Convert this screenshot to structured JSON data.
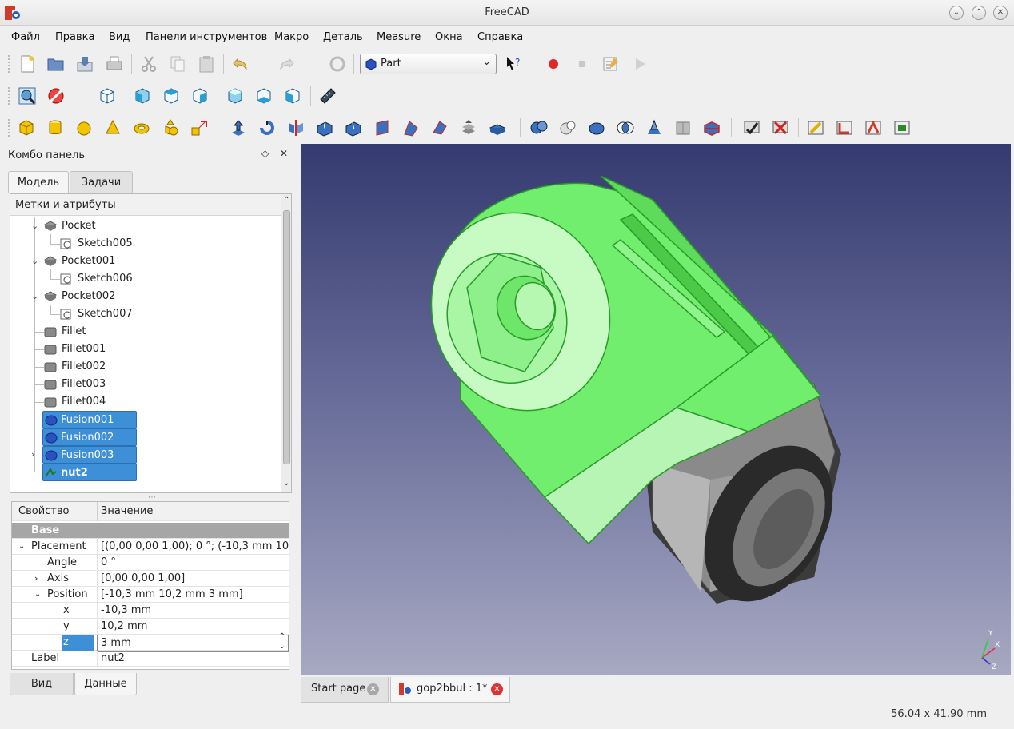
{
  "window": {
    "title": "FreeCAD"
  },
  "menu": [
    "Файл",
    "Правка",
    "Вид",
    "Панели инструментов",
    "Макро",
    "Деталь",
    "Measure",
    "Окна",
    "Справка"
  ],
  "workbench": {
    "selected": "Part"
  },
  "combo": {
    "title": "Комбо панель",
    "tabs": [
      "Модель",
      "Задачи"
    ],
    "tree_header": "Метки и атрибуты",
    "tree_items": [
      "Pocket",
      "Sketch005",
      "Pocket001",
      "Sketch006",
      "Pocket002",
      "Sketch007",
      "Fillet",
      "Fillet001",
      "Fillet002",
      "Fillet003",
      "Fillet004",
      "Fusion001",
      "Fusion002",
      "Fusion003",
      "nut2"
    ],
    "prop_headers": [
      "Свойство",
      "Значение"
    ],
    "prop_group": "Base",
    "props": {
      "placement": {
        "name": "Placement",
        "value": "[(0,00 0,00 1,00); 0 °; (-10,3 mm  10,..."
      },
      "angle": {
        "name": "Angle",
        "value": "0 °"
      },
      "axis": {
        "name": "Axis",
        "value": "[0,00 0,00 1,00]"
      },
      "position": {
        "name": "Position",
        "value": "[-10,3 mm  10,2 mm  3 mm]"
      },
      "x": {
        "name": "x",
        "value": "-10,3 mm"
      },
      "y": {
        "name": "y",
        "value": "10,2 mm"
      },
      "z": {
        "name": "z",
        "value": "3 mm"
      },
      "label": {
        "name": "Label",
        "value": "nut2"
      }
    },
    "bottom_tabs": [
      "Вид",
      "Данные"
    ]
  },
  "doc_tabs": [
    "Start page",
    "gop2bbul : 1*"
  ],
  "status": {
    "dimensions": "56.04 x 41.90 mm"
  },
  "axis_labels": {
    "x": "X",
    "y": "Y",
    "z": "Z"
  },
  "colors": {
    "selection": "#3d8fd8",
    "model_green": "#6ef06a",
    "viewport_top": "#353a70",
    "viewport_bottom": "#a7a9c2"
  }
}
